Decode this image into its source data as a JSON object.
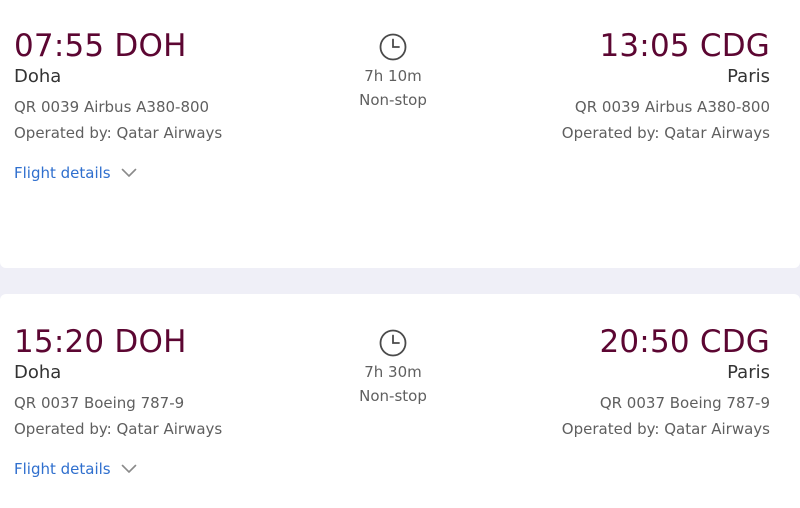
{
  "flights": [
    {
      "departure": {
        "time": "07:55",
        "code": "DOH",
        "city": "Doha",
        "flight": "QR 0039 Airbus A380-800",
        "operator": "Operated by: Qatar Airways"
      },
      "arrival": {
        "time": "13:05",
        "code": "CDG",
        "city": "Paris",
        "flight": "QR 0039 Airbus A380-800",
        "operator": "Operated by: Qatar Airways"
      },
      "duration": "7h 10m",
      "stops": "Non-stop",
      "details_label": "Flight details",
      "clock_icon": "clock-icon",
      "chevron_icon": "chevron-down-icon"
    },
    {
      "departure": {
        "time": "15:20",
        "code": "DOH",
        "city": "Doha",
        "flight": "QR 0037 Boeing 787-9",
        "operator": "Operated by: Qatar Airways"
      },
      "arrival": {
        "time": "20:50",
        "code": "CDG",
        "city": "Paris",
        "flight": "QR 0037 Boeing 787-9",
        "operator": "Operated by: Qatar Airways"
      },
      "duration": "7h 30m",
      "stops": "Non-stop",
      "details_label": "Flight details",
      "clock_icon": "clock-icon",
      "chevron_icon": "chevron-down-icon"
    }
  ],
  "colors": {
    "time": "#5c0632",
    "link": "#2f6fce",
    "secondary_text": "#5f5f5f",
    "separator": "#efeff7"
  }
}
